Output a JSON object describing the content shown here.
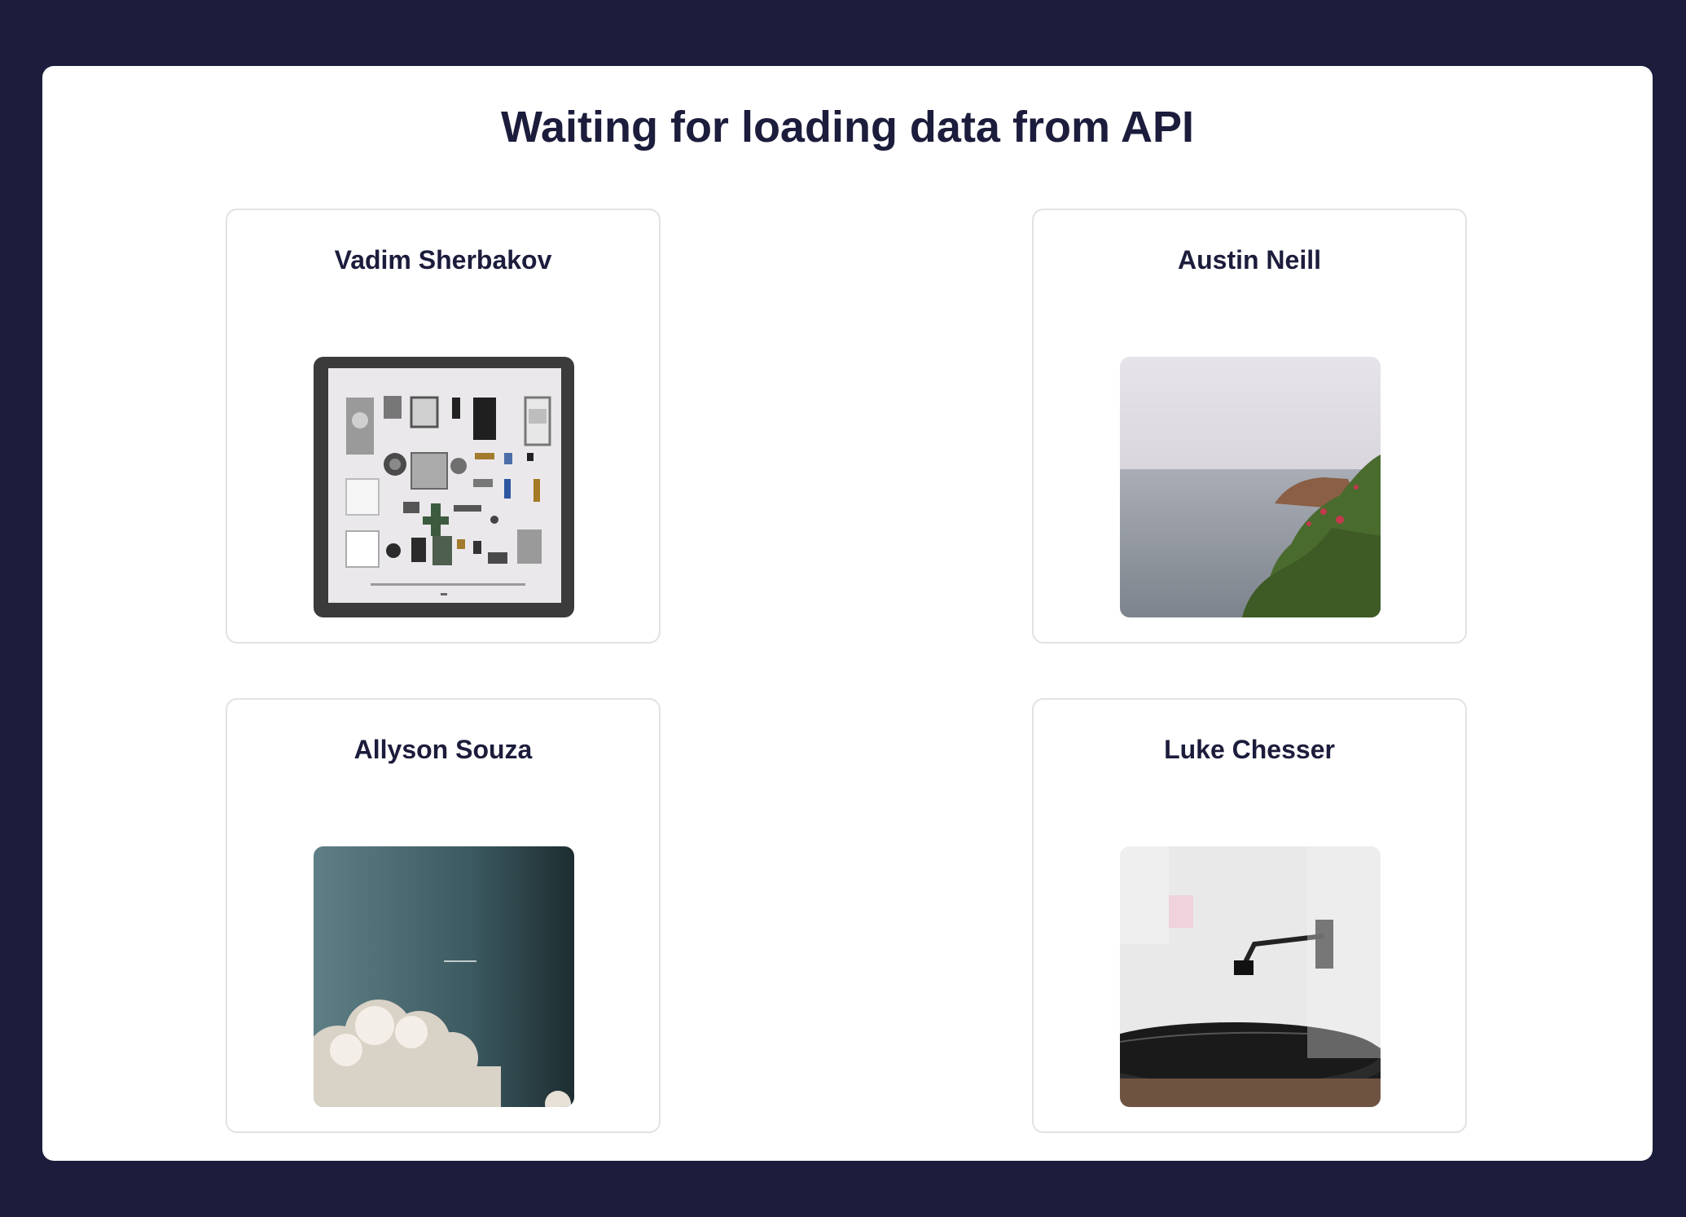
{
  "page": {
    "title": "Waiting for loading data from API",
    "background_color": "#1c1c3c",
    "panel_color": "#ffffff",
    "text_color": "#1c1c3c"
  },
  "cards": [
    {
      "author": "Vadim Sherbakov",
      "image": "flat-lay-disassembled-camera-parts-photo"
    },
    {
      "author": "Austin Neill",
      "image": "coastline-sea-flowers-photo"
    },
    {
      "author": "Allyson Souza",
      "image": "clouds-sky-photo"
    },
    {
      "author": "Luke Chesser",
      "image": "record-player-turntable-photo"
    }
  ]
}
